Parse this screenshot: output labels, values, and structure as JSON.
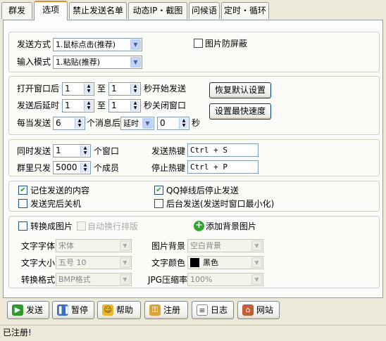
{
  "tabs": [
    "群发",
    "选项",
    "禁止发送名单",
    "动态IP・截图",
    "问候语",
    "定时・循环"
  ],
  "group1": {
    "send_mode_label": "发送方式",
    "send_mode_value": "1.鼠标点击(推荐)",
    "input_mode_label": "输入模式",
    "input_mode_value": "1.粘贴(推荐)",
    "image_protect_label": "图片防屏蔽",
    "image_protect_checked": false
  },
  "group2": {
    "open_after_label": "打开窗口后",
    "open_after_from": "1",
    "to1": "至",
    "open_after_to": "1",
    "start_send_label": "秒开始发送",
    "delay_label": "发送后延时",
    "delay_from": "1",
    "to2": "至",
    "delay_to": "1",
    "close_label": "秒关闭窗口",
    "every_label": "每当发送",
    "every_value": "6",
    "msgs_after_label": "个消息后",
    "delay_type_value": "延时",
    "delay_seconds": "0",
    "seconds_label": "秒",
    "restore_default_button": "恢复默认设置",
    "fastest_button": "设置最快速度"
  },
  "group3": {
    "concurrent_label": "同时发送",
    "concurrent_value": "1",
    "windows_label": "个窗口",
    "group_only_label": "群里只发",
    "group_only_value": "5000",
    "members_label": "个成员",
    "send_hotkey_label": "发送热键",
    "send_hotkey_value": "Ctrl + S",
    "stop_hotkey_label": "停止热键",
    "stop_hotkey_value": "Ctrl + P"
  },
  "group4": {
    "remember_label": "记住发送的内容",
    "remember_checked": true,
    "shutdown_label": "发送完后关机",
    "shutdown_checked": false,
    "qq_offline_label": "QQ掉线后停止发送",
    "qq_offline_checked": true,
    "background_label": "后台发送(发送时窗口最小化)",
    "background_checked": false
  },
  "group5": {
    "convert_image_label": "转换成图片",
    "auto_wrap_label": "自动换行排版",
    "add_bg_label": "添加背景图片",
    "font_label": "文字字体",
    "font_value": "宋体",
    "size_label": "文字大小",
    "size_value": "五号 10",
    "format_label": "转换格式",
    "format_value": "BMP格式",
    "bg_label": "图片背景",
    "bg_value": "空白背景",
    "color_label": "文字颜色",
    "color_value": "黑色",
    "jpg_label": "JPG压缩率",
    "jpg_value": "100%"
  },
  "buttons": {
    "send": "发送",
    "pause": "暂停",
    "help": "帮助",
    "register": "注册",
    "log": "日志",
    "website": "网站"
  },
  "status": "已注册!",
  "colors": {
    "accent_tab": "#e68b2c",
    "check_green": "#21a121",
    "text_color_swatch": "#000000"
  }
}
